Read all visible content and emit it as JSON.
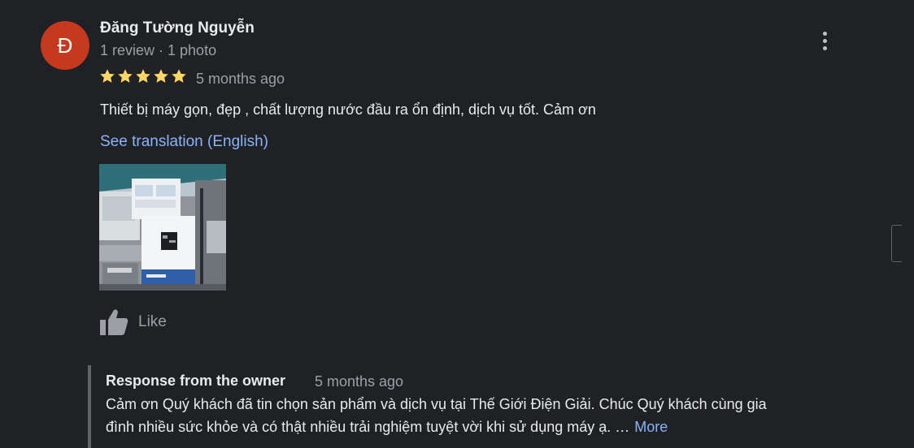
{
  "review": {
    "avatar_letter": "Đ",
    "avatar_color": "#c5391f",
    "author_name": "Đăng Tường Nguyễn",
    "author_meta": "1 review · 1 photo",
    "rating": 5,
    "rating_max": 5,
    "star_color": "#fdd663",
    "time_ago": "5 months ago",
    "text": "Thiết bị máy gọn, đẹp , chất lượng nước đầu ra ổn định, dịch vụ tốt. Cảm ơn",
    "translate_label": "See translation (English)",
    "photo_count": 1,
    "more_menu_icon": "more-vert-icon",
    "like_icon": "thumb-up-icon",
    "like_label": "Like"
  },
  "owner_response": {
    "title": "Response from the owner",
    "time_ago": "5 months ago",
    "line1": "Cảm ơn Quý khách đã tin chọn sản phẩm và dịch vụ tại Thế Giới Điện Giải. Chúc Quý khách cùng gia",
    "line2": "đình nhiều sức khỏe và có thật nhiều trải nghiệm tuyệt vời khi sử dụng máy ạ. …",
    "more_label": "More"
  },
  "colors": {
    "background": "#202124",
    "text_primary": "#e8eaed",
    "text_secondary": "#9aa0a6",
    "link": "#8ab4f8",
    "divider": "#5f6368"
  }
}
